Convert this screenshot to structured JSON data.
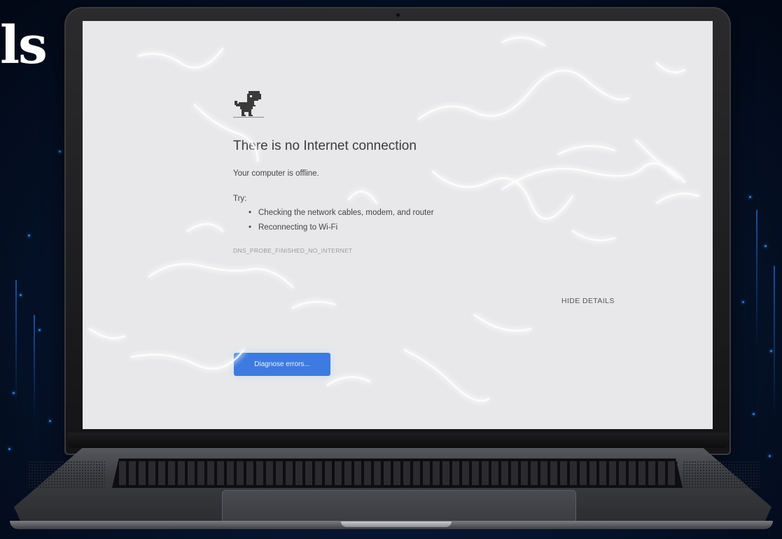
{
  "headline": {
    "text": "ls"
  },
  "error_page": {
    "icon": "dinosaur-icon",
    "title": "There is no Internet connection",
    "subtitle": "Your computer is offline.",
    "try_label": "Try:",
    "suggestions": [
      "Checking the network cables, modem, and router",
      "Reconnecting to Wi-Fi"
    ],
    "error_code": "DNS_PROBE_FINISHED_NO_INTERNET",
    "hide_details_label": "HIDE DETAILS",
    "diagnose_button_label": "Diagnose errors..."
  },
  "colors": {
    "background": "#061530",
    "screen": "#e8e8ea",
    "button": "#3d7be0",
    "accent_particles": "#2f8cff",
    "lightning": "#cfe9ff"
  }
}
